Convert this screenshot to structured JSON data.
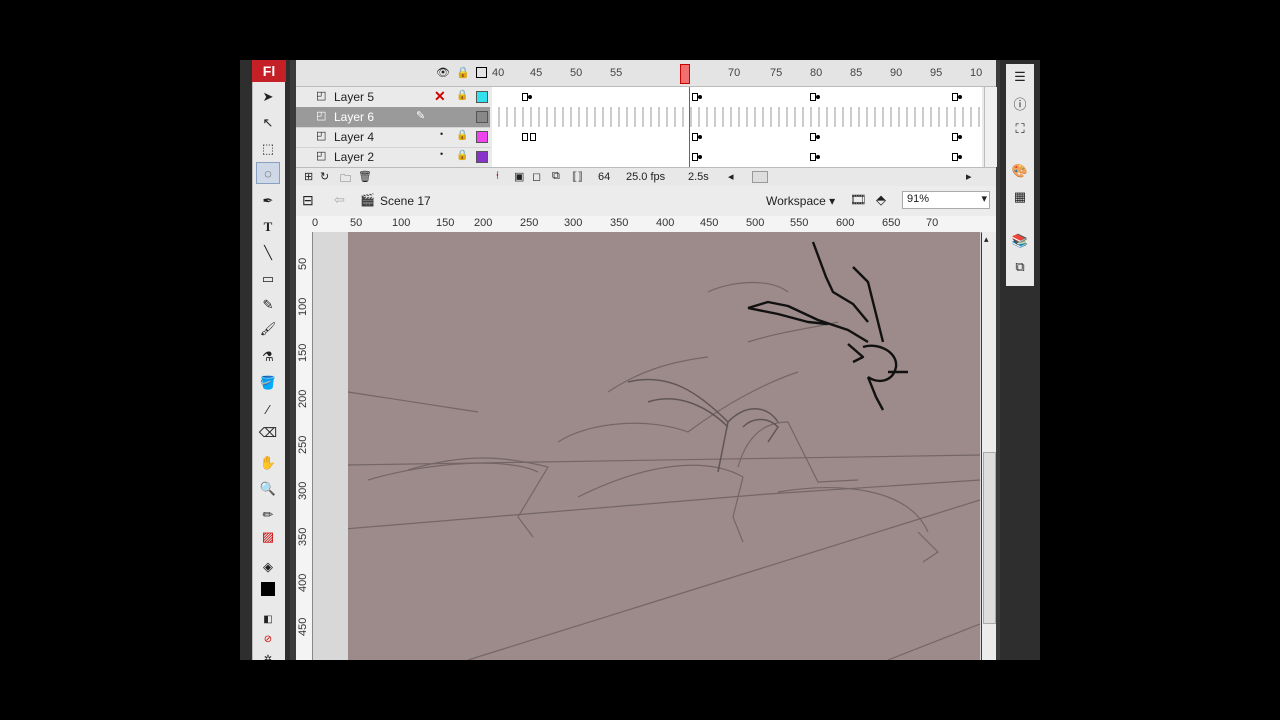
{
  "app": {
    "logo": "Fl"
  },
  "timeline": {
    "layers": [
      {
        "name": "Layer 5",
        "color": "#33e0ee"
      },
      {
        "name": "Layer 6",
        "color": "#888888"
      },
      {
        "name": "Layer 4",
        "color": "#ee44ee"
      },
      {
        "name": "Layer 2",
        "color": "#8833cc"
      }
    ],
    "ruler_labels": [
      "40",
      "45",
      "50",
      "55",
      "70",
      "75",
      "80",
      "85",
      "90",
      "95",
      "10"
    ],
    "current_frame": "64",
    "fps": "25.0 fps",
    "elapsed": "2.5s"
  },
  "editbar": {
    "scene": "Scene 17",
    "workspace": "Workspace ▾",
    "zoom": "91%"
  },
  "stage": {
    "ruler_top": [
      "0",
      "50",
      "100",
      "150",
      "200",
      "250",
      "300",
      "350",
      "400",
      "450",
      "500",
      "550",
      "600",
      "650",
      "70"
    ],
    "ruler_left": [
      "50",
      "100",
      "150",
      "200",
      "250",
      "300",
      "350",
      "400",
      "450"
    ],
    "background_color": "#9d8a8a"
  },
  "tools": {
    "icons": [
      "selection-icon",
      "subselection-icon",
      "free-transform-icon",
      "lasso-icon",
      "pen-icon",
      "text-icon",
      "line-icon",
      "rectangle-icon",
      "pencil-icon",
      "brush-icon",
      "ink-bottle-icon",
      "paint-bucket-icon",
      "eyedropper-icon",
      "eraser-icon",
      "hand-icon",
      "zoom-icon",
      "stroke-color-icon",
      "fill-color-icon"
    ]
  }
}
